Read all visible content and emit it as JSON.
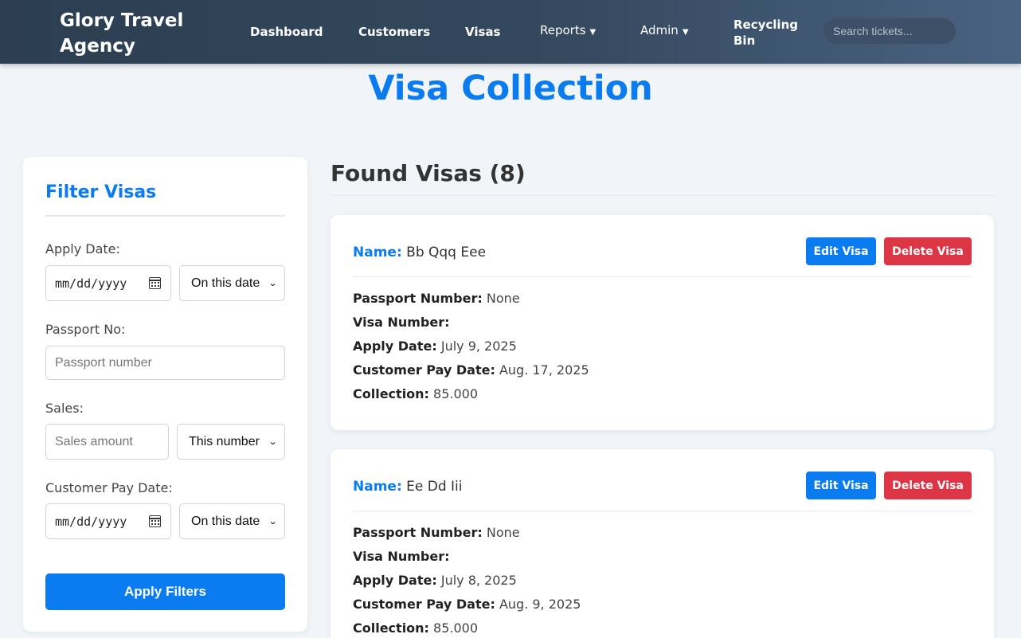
{
  "navbar": {
    "brand": "Glory Travel Agency",
    "links": [
      "Dashboard",
      "Customers",
      "Visas"
    ],
    "reports": "Reports",
    "admin": "Admin",
    "recycling_bin": "Recycling Bin",
    "search_placeholder": "Search tickets...",
    "dropdown_icon": "caret-down-icon"
  },
  "page_title": "Visa Collection",
  "filter": {
    "title": "Filter Visas",
    "apply_date_label": "Apply Date:",
    "apply_date_placeholder": "mm/dd/yyyy",
    "apply_date_mode": "On this date",
    "passport_label": "Passport No:",
    "passport_placeholder": "Passport number",
    "sales_label": "Sales:",
    "sales_placeholder": "Sales amount",
    "sales_mode": "This number",
    "pay_date_label": "Customer Pay Date:",
    "pay_date_placeholder": "mm/dd/yyyy",
    "pay_date_mode": "On this date",
    "apply_button": "Apply Filters"
  },
  "results": {
    "heading": "Found Visas (8)",
    "field_labels": {
      "name": "Name:",
      "passport": "Passport Number:",
      "visa": "Visa Number:",
      "apply_date": "Apply Date:",
      "pay_date": "Customer Pay Date:",
      "collection": "Collection:"
    },
    "edit_label": "Edit Visa",
    "delete_label": "Delete Visa",
    "visas": [
      {
        "name": "Bb Qqq Eee",
        "passport": "None",
        "visa": "",
        "apply_date": "July 9, 2025",
        "pay_date": "Aug. 17, 2025",
        "collection": "85.000"
      },
      {
        "name": "Ee Dd Iii",
        "passport": "None",
        "visa": "",
        "apply_date": "July 8, 2025",
        "pay_date": "Aug. 9, 2025",
        "collection": "85.000"
      }
    ]
  },
  "colors": {
    "accent": "#0a7cf0",
    "danger": "#dc3545",
    "nav_start": "#2c3e50",
    "nav_end": "#4a6282"
  }
}
